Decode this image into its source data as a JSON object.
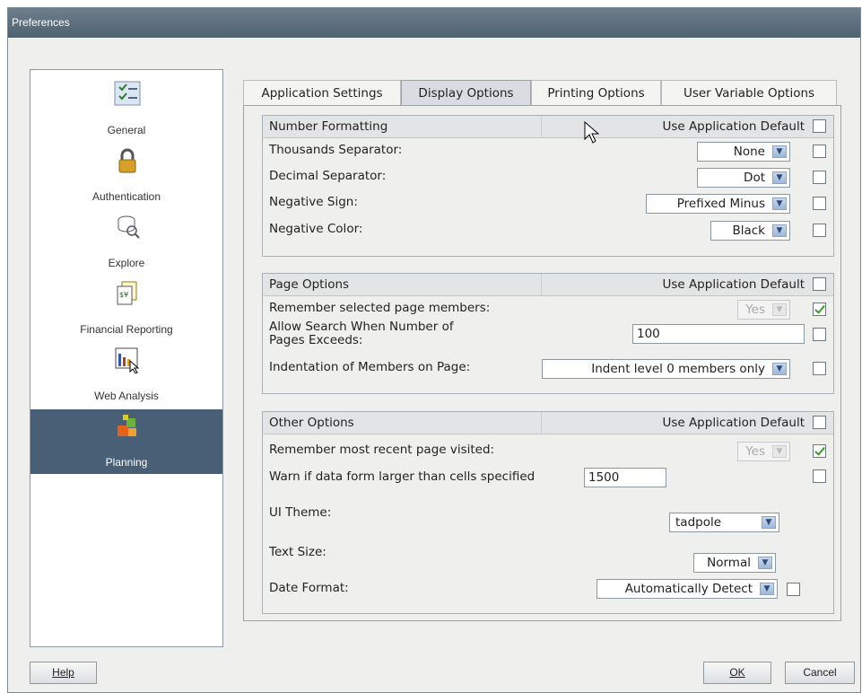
{
  "window": {
    "title": "Preferences"
  },
  "sidebar": {
    "items": [
      {
        "label": "General",
        "icon": "checklist-icon"
      },
      {
        "label": "Authentication",
        "icon": "padlock-icon"
      },
      {
        "label": "Explore",
        "icon": "database-search-icon"
      },
      {
        "label": "Financial Reporting",
        "icon": "report-document-icon"
      },
      {
        "label": "Web Analysis",
        "icon": "bar-chart-icon"
      },
      {
        "label": "Planning",
        "icon": "planning-blocks-icon",
        "selected": true
      }
    ]
  },
  "tabs": [
    {
      "label": "Application Settings"
    },
    {
      "label": "Display Options",
      "active": true
    },
    {
      "label": "Printing Options"
    },
    {
      "label": "User Variable Options"
    }
  ],
  "number_formatting": {
    "title": "Number Formatting",
    "use_default_label": "Use Application Default",
    "use_default_checked": false,
    "rows": [
      {
        "label": "Thousands Separator:",
        "value": "None",
        "checked": false
      },
      {
        "label": "Decimal Separator:",
        "value": "Dot",
        "checked": false
      },
      {
        "label": "Negative Sign:",
        "value": "Prefixed Minus",
        "checked": false
      },
      {
        "label": "Negative Color:",
        "value": "Black",
        "checked": false
      }
    ]
  },
  "page_options": {
    "title": "Page Options",
    "use_default_label": "Use Application Default",
    "use_default_checked": false,
    "remember_label": "Remember selected page members:",
    "remember_value": "Yes",
    "remember_checked": true,
    "search_label_line1": "Allow Search When Number of",
    "search_label_line2": "Pages Exceeds:",
    "search_value": "100",
    "search_checked": false,
    "indent_label": "Indentation of Members on Page:",
    "indent_value": "Indent level 0 members only",
    "indent_checked": false
  },
  "other_options": {
    "title": "Other Options",
    "use_default_label": "Use Application Default",
    "use_default_checked": false,
    "recent_label": "Remember most recent page visited:",
    "recent_value": "Yes",
    "recent_checked": true,
    "warn_label": "Warn if data form larger than cells specified",
    "warn_value": "1500",
    "warn_checked": false,
    "theme_label": "UI Theme:",
    "theme_value": "tadpole",
    "text_size_label": "Text Size:",
    "text_size_value": "Normal",
    "date_format_label": "Date Format:",
    "date_format_value": "Automatically Detect",
    "date_format_checked": false
  },
  "buttons": {
    "help": "Help",
    "ok": "OK",
    "cancel": "Cancel"
  }
}
